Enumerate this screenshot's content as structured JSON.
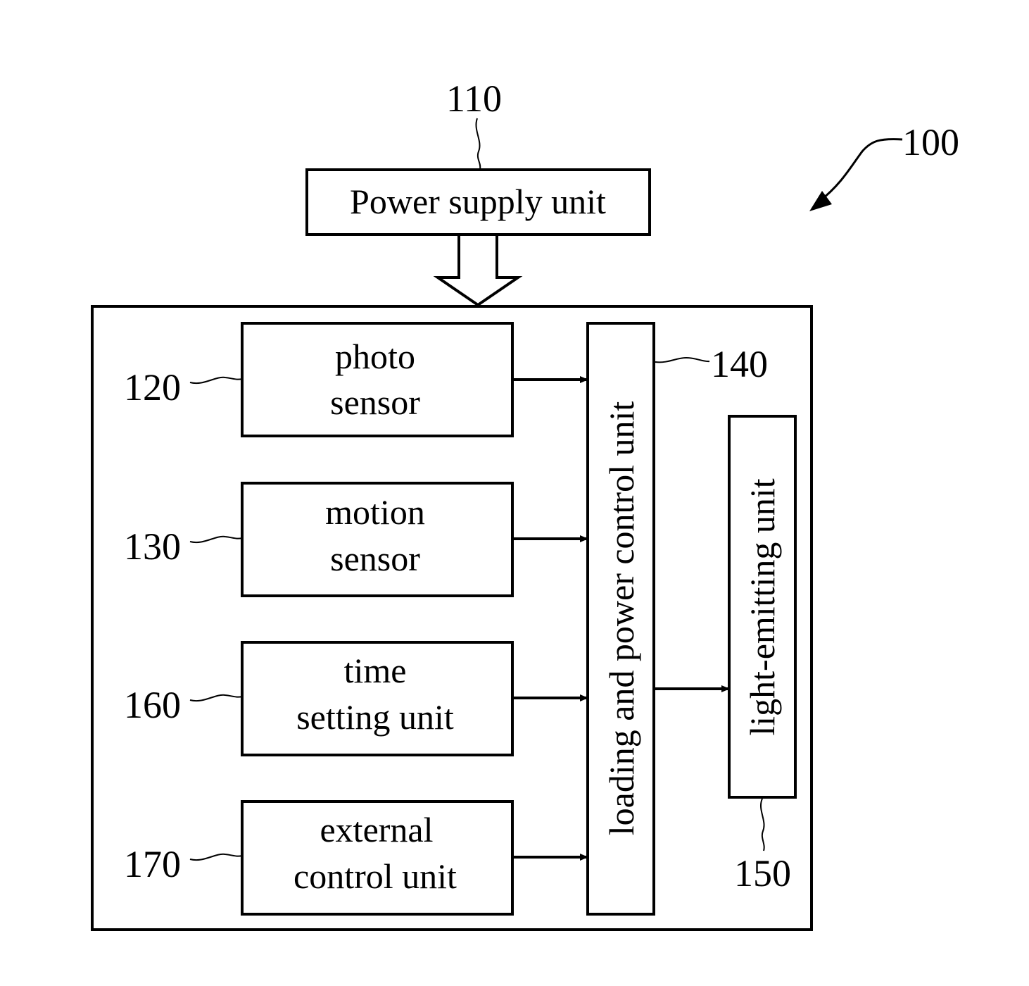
{
  "figure": {
    "system_ref": "100",
    "blocks": {
      "power_supply": {
        "ref": "110",
        "label": "Power supply unit"
      },
      "photo_sensor": {
        "ref": "120",
        "lines": [
          "photo",
          "sensor"
        ]
      },
      "motion_sensor": {
        "ref": "130",
        "lines": [
          "motion",
          "sensor"
        ]
      },
      "time_setting": {
        "ref": "160",
        "lines": [
          "time",
          "setting unit"
        ]
      },
      "external_control": {
        "ref": "170",
        "lines": [
          "external",
          "control unit"
        ]
      },
      "loading_power_control": {
        "ref": "140",
        "label": "loading and power control unit"
      },
      "light_emitting": {
        "ref": "150",
        "label": "light-emitting unit"
      }
    },
    "connections": [
      {
        "from": "power_supply",
        "to": "system_enclosure",
        "style": "hollow-arrow"
      },
      {
        "from": "photo_sensor",
        "to": "loading_power_control",
        "style": "arrow"
      },
      {
        "from": "motion_sensor",
        "to": "loading_power_control",
        "style": "arrow"
      },
      {
        "from": "time_setting",
        "to": "loading_power_control",
        "style": "arrow"
      },
      {
        "from": "external_control",
        "to": "loading_power_control",
        "style": "arrow"
      },
      {
        "from": "loading_power_control",
        "to": "light_emitting",
        "style": "arrow"
      }
    ]
  }
}
